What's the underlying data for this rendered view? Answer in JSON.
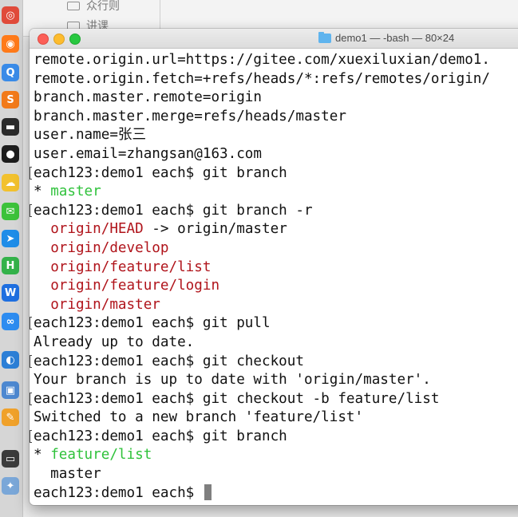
{
  "background_window": {
    "rows": [
      "众行则",
      "讲课"
    ]
  },
  "dock": {
    "icons": [
      {
        "name": "chrome-icon",
        "color": "#e04a3a"
      },
      {
        "name": "firefox-icon",
        "color": "#ff7a1a"
      },
      {
        "name": "qq-browser-icon",
        "color": "#3a8be8"
      },
      {
        "name": "sublime-text-icon",
        "color": "#f27a1a"
      },
      {
        "name": "terminal-icon",
        "color": "#2b2b2b"
      },
      {
        "name": "qq-icon",
        "color": "#1d1d1d"
      },
      {
        "name": "notes-icon",
        "color": "#f2c12e"
      },
      {
        "name": "wechat-icon",
        "color": "#3cc23a"
      },
      {
        "name": "paper-plane-icon",
        "color": "#1f8de8"
      },
      {
        "name": "hbuilder-icon",
        "color": "#34b24a"
      },
      {
        "name": "wps-icon",
        "color": "#1f6fe0"
      },
      {
        "name": "baidu-netdisk-icon",
        "color": "#2d8cf0"
      },
      {
        "name": "navicat-icon",
        "color": "#2c7fd6"
      },
      {
        "name": "preview-icon",
        "color": "#4d88d0"
      },
      {
        "name": "sketch-icon",
        "color": "#f0a12a"
      },
      {
        "name": "screen-capture-icon",
        "color": "#3b3b3b"
      },
      {
        "name": "app-store-icon",
        "color": "#7aa7d8"
      }
    ]
  },
  "window": {
    "title": "demo1 — -bash — 80×24",
    "folder_color": "#5fb4ee"
  },
  "terminal": {
    "lines": [
      {
        "mark": false,
        "segs": [
          {
            "t": "remote.origin.url=https://gitee.com/xuexiluxian/demo1.",
            "c": "default"
          }
        ]
      },
      {
        "mark": false,
        "segs": [
          {
            "t": "remote.origin.fetch=+refs/heads/*:refs/remotes/origin/",
            "c": "default"
          }
        ]
      },
      {
        "mark": false,
        "segs": [
          {
            "t": "branch.master.remote=origin",
            "c": "default"
          }
        ]
      },
      {
        "mark": false,
        "segs": [
          {
            "t": "branch.master.merge=refs/heads/master",
            "c": "default"
          }
        ]
      },
      {
        "mark": false,
        "segs": [
          {
            "t": "user.name=张三",
            "c": "default"
          }
        ]
      },
      {
        "mark": false,
        "segs": [
          {
            "t": "user.email=zhangsan@163.com",
            "c": "default"
          }
        ]
      },
      {
        "mark": true,
        "segs": [
          {
            "t": "each123:demo1 each$ git branch",
            "c": "default"
          }
        ]
      },
      {
        "mark": false,
        "segs": [
          {
            "t": "* ",
            "c": "default"
          },
          {
            "t": "master",
            "c": "green"
          }
        ]
      },
      {
        "mark": true,
        "segs": [
          {
            "t": "each123:demo1 each$ git branch -r",
            "c": "default"
          }
        ]
      },
      {
        "mark": false,
        "segs": [
          {
            "t": "  ",
            "c": "default"
          },
          {
            "t": "origin/HEAD",
            "c": "red"
          },
          {
            "t": " -> origin/master",
            "c": "default"
          }
        ]
      },
      {
        "mark": false,
        "segs": [
          {
            "t": "  ",
            "c": "default"
          },
          {
            "t": "origin/develop",
            "c": "red"
          }
        ]
      },
      {
        "mark": false,
        "segs": [
          {
            "t": "  ",
            "c": "default"
          },
          {
            "t": "origin/feature/list",
            "c": "red"
          }
        ]
      },
      {
        "mark": false,
        "segs": [
          {
            "t": "  ",
            "c": "default"
          },
          {
            "t": "origin/feature/login",
            "c": "red"
          }
        ]
      },
      {
        "mark": false,
        "segs": [
          {
            "t": "  ",
            "c": "default"
          },
          {
            "t": "origin/master",
            "c": "red"
          }
        ]
      },
      {
        "mark": true,
        "segs": [
          {
            "t": "each123:demo1 each$ git pull",
            "c": "default"
          }
        ]
      },
      {
        "mark": false,
        "segs": [
          {
            "t": "Already up to date.",
            "c": "default"
          }
        ]
      },
      {
        "mark": true,
        "segs": [
          {
            "t": "each123:demo1 each$ git checkout",
            "c": "default"
          }
        ]
      },
      {
        "mark": false,
        "segs": [
          {
            "t": "Your branch is up to date with 'origin/master'.",
            "c": "default"
          }
        ]
      },
      {
        "mark": true,
        "segs": [
          {
            "t": "each123:demo1 each$ git checkout -b feature/list",
            "c": "default"
          }
        ]
      },
      {
        "mark": false,
        "segs": [
          {
            "t": "Switched to a new branch 'feature/list'",
            "c": "default"
          }
        ]
      },
      {
        "mark": true,
        "segs": [
          {
            "t": "each123:demo1 each$ git branch",
            "c": "default"
          }
        ]
      },
      {
        "mark": false,
        "segs": [
          {
            "t": "* ",
            "c": "default"
          },
          {
            "t": "feature/list",
            "c": "green"
          }
        ]
      },
      {
        "mark": false,
        "segs": [
          {
            "t": "  master",
            "c": "default"
          }
        ]
      }
    ],
    "prompt": "each123:demo1 each$ ",
    "colors": {
      "green": "#2fc23b",
      "red": "#b0141b",
      "default": "#111111"
    }
  }
}
